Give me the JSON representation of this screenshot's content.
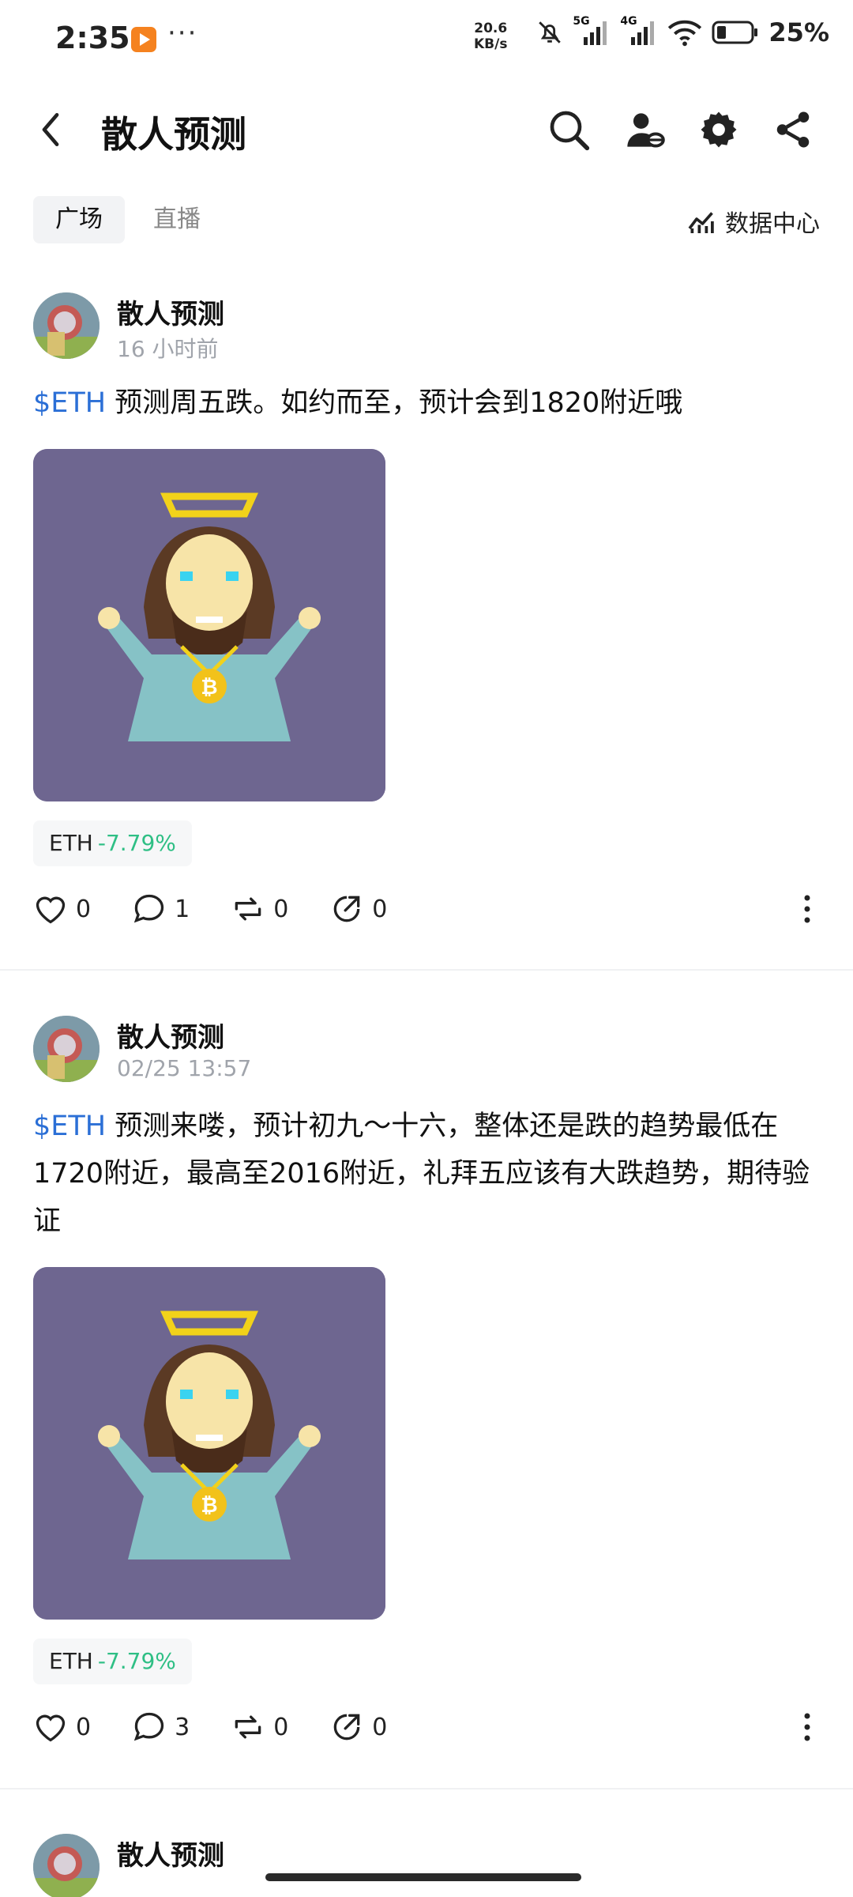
{
  "status_bar": {
    "time": "2:35",
    "speed_top": "20.6",
    "speed_bottom": "KB/s",
    "net1": "5G",
    "net2": "4G",
    "battery": "25%",
    "icons": [
      "app-notification-icon",
      "more-dots-icon",
      "mute-bell-icon",
      "signal-5g-icon",
      "signal-4g-icon",
      "wifi-icon",
      "battery-icon"
    ]
  },
  "nav": {
    "title": "散人预测",
    "icons": [
      "back-arrow-icon",
      "search-icon",
      "user-coin-icon",
      "gear-icon",
      "share-icon"
    ]
  },
  "tabs": [
    {
      "label": "广场",
      "active": true
    },
    {
      "label": "直播",
      "active": false
    }
  ],
  "data_center": {
    "label": "数据中心",
    "icon": "chart-trend-icon"
  },
  "colors": {
    "tag_blue": "#2b6fd6",
    "pct_green": "#2fbf85",
    "image_bg": "#6e6690"
  },
  "posts": [
    {
      "author": "散人预测",
      "time": "16 小时前",
      "tag": "$ETH",
      "text": " 预测周五跌。如约而至，预计会到1820附近哦",
      "chip_symbol": "ETH",
      "chip_change": "-7.79%",
      "likes": "0",
      "comments": "1",
      "reposts": "0",
      "shares": "0"
    },
    {
      "author": "散人预测",
      "time": "02/25 13:57",
      "tag": "$ETH",
      "text": " 预测来喽，预计初九～十六，整体还是跌的趋势最低在1720附近，最高至2016附近，礼拜五应该有大跌趋势，期待验证",
      "chip_symbol": "ETH",
      "chip_change": "-7.79%",
      "likes": "0",
      "comments": "3",
      "reposts": "0",
      "shares": "0"
    },
    {
      "author": "散人预测"
    }
  ]
}
